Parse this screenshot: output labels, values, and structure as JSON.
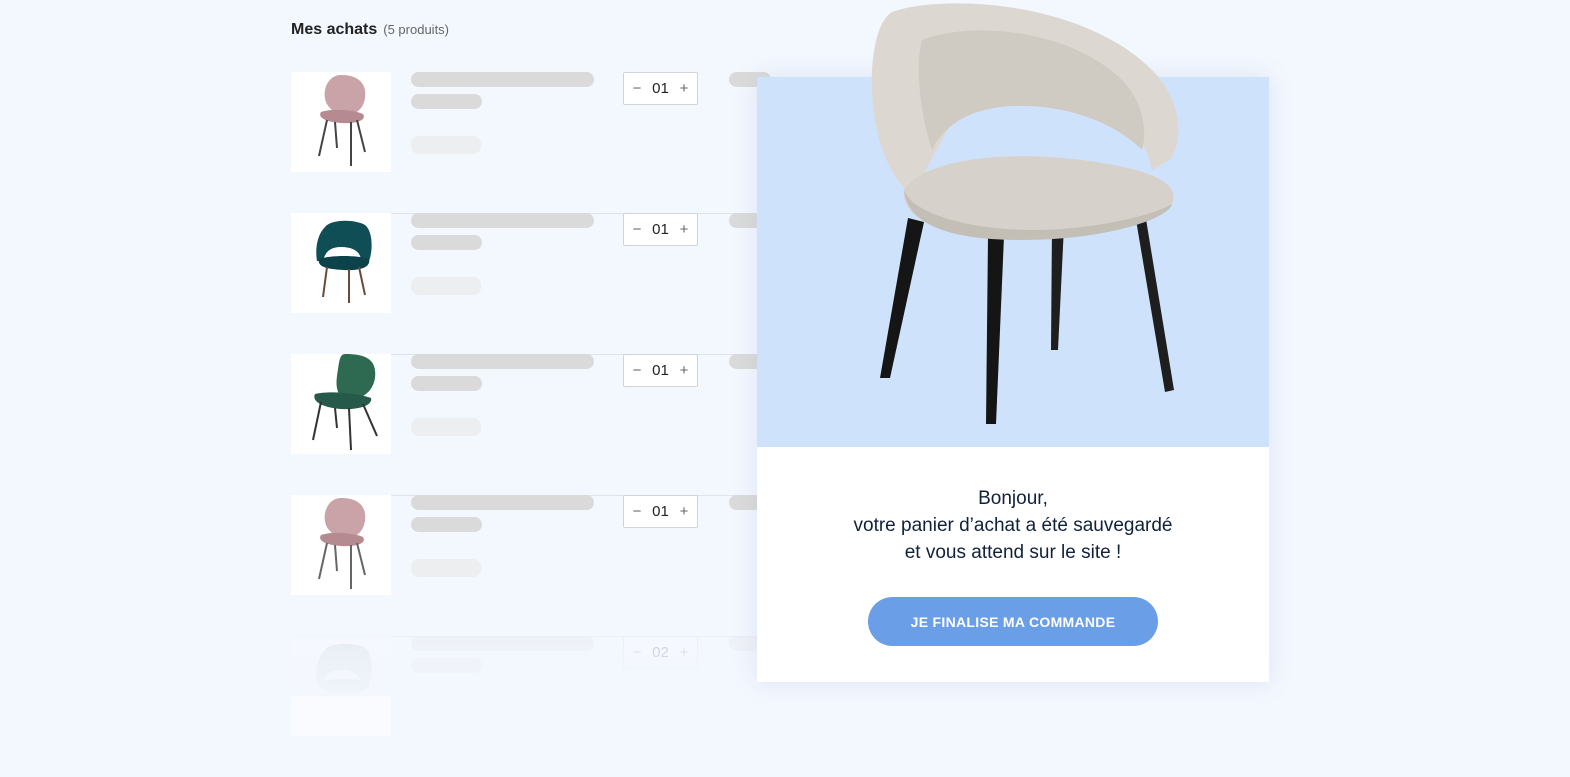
{
  "cart": {
    "title": "Mes achats",
    "count": "(5 produits)",
    "items": [
      {
        "qty": "01",
        "minus": "−",
        "plus": "+",
        "image": "pink-chair-image",
        "color": "#c9a3a8"
      },
      {
        "qty": "01",
        "minus": "−",
        "plus": "+",
        "image": "teal-armchair-image",
        "color": "#0f4e55"
      },
      {
        "qty": "01",
        "minus": "−",
        "plus": "+",
        "image": "green-chair-image",
        "color": "#2e6a52"
      },
      {
        "qty": "01",
        "minus": "−",
        "plus": "+",
        "image": "pink-chair-image",
        "color": "#c9a3a8"
      },
      {
        "qty": "02",
        "minus": "−",
        "plus": "+",
        "image": "grey-armchair-image",
        "color": "#b4c6c6"
      }
    ]
  },
  "popup": {
    "image": "beige-armchair-image",
    "line1": "Bonjour,",
    "line2": "votre panier d’achat a été sauvegardé",
    "line3": "et vous attend sur le site !",
    "cta": "JE FINALISE MA COMMANDE",
    "hero_bg": "#cfe2fc",
    "cta_color": "#6a9ee6"
  }
}
